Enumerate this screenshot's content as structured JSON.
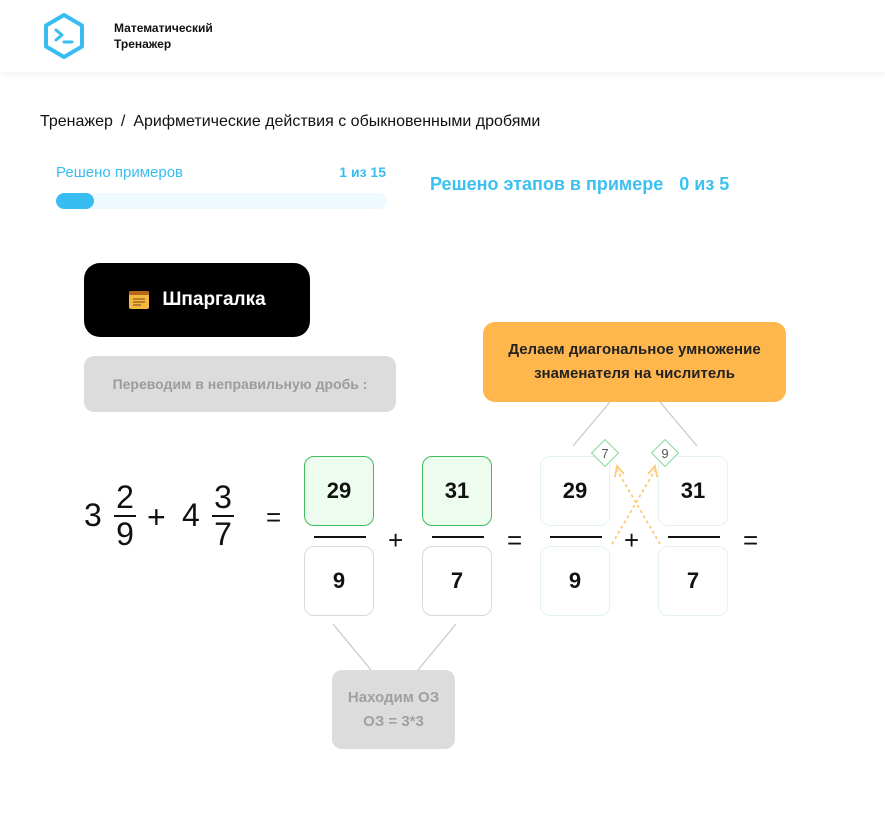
{
  "header": {
    "brand_line1": "Математический",
    "brand_line2": "Тренажер",
    "logo_icon": "terminal-hexagon-icon",
    "logo_color": "#38bdf2"
  },
  "breadcrumb": {
    "root": "Тренажер",
    "separator": "/",
    "current": "Арифметические действия с обыкновенными дробями"
  },
  "progress": {
    "label": "Решено примеров",
    "count": "1 из 15",
    "fraction": 0.115,
    "color": "#38bdf2"
  },
  "stage": {
    "label": "Решено этапов в примере",
    "count": "0 из 5"
  },
  "cheat_sheet": {
    "label": "Шпаргалка",
    "icon": "notepad-icon"
  },
  "hint_box": {
    "text": "Переводим в неправильную дробь :"
  },
  "orange_hint": {
    "line1": "Делаем диагональное умножение",
    "line2": "знаменателя на числитель",
    "color": "#ffb74d"
  },
  "common_denominator": {
    "line1": "Находим ОЗ",
    "line2": "ОЗ = 3*3"
  },
  "expression": {
    "term1": {
      "whole": "3",
      "numerator": "2",
      "denominator": "9"
    },
    "plus1": "+",
    "term2": {
      "whole": "4",
      "numerator": "3",
      "denominator": "7"
    },
    "equals1": "=",
    "step1": {
      "frac1": {
        "numerator": "29",
        "denominator": "9"
      },
      "plus": "+",
      "frac2": {
        "numerator": "31",
        "denominator": "7"
      }
    },
    "equals2": "=",
    "step2": {
      "frac1": {
        "numerator": "29",
        "denominator": "9"
      },
      "plus": "+",
      "frac2": {
        "numerator": "31",
        "denominator": "7"
      },
      "factor1": "7",
      "factor2": "9"
    },
    "equals3": "="
  }
}
